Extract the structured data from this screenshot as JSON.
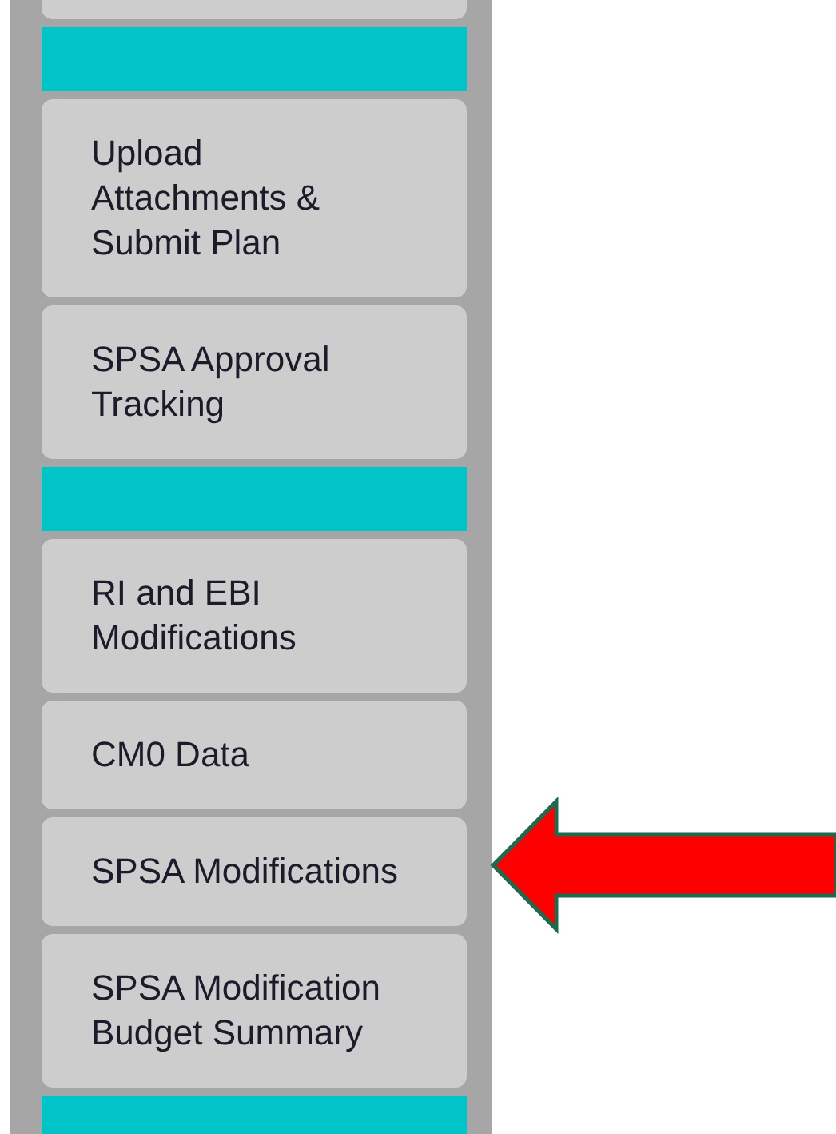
{
  "sidebar": {
    "items": [
      {
        "kind": "button"
      },
      {
        "kind": "divider"
      },
      {
        "kind": "button",
        "label": "Upload Attachments & Submit Plan"
      },
      {
        "kind": "button",
        "label": "SPSA Approval Tracking"
      },
      {
        "kind": "divider"
      },
      {
        "kind": "button",
        "label": "RI and EBI Modifications"
      },
      {
        "kind": "button",
        "label": "CM0 Data"
      },
      {
        "kind": "button",
        "label": "SPSA Modifications"
      },
      {
        "kind": "button",
        "label": "SPSA Modification Budget Summary"
      },
      {
        "kind": "divider"
      }
    ]
  }
}
